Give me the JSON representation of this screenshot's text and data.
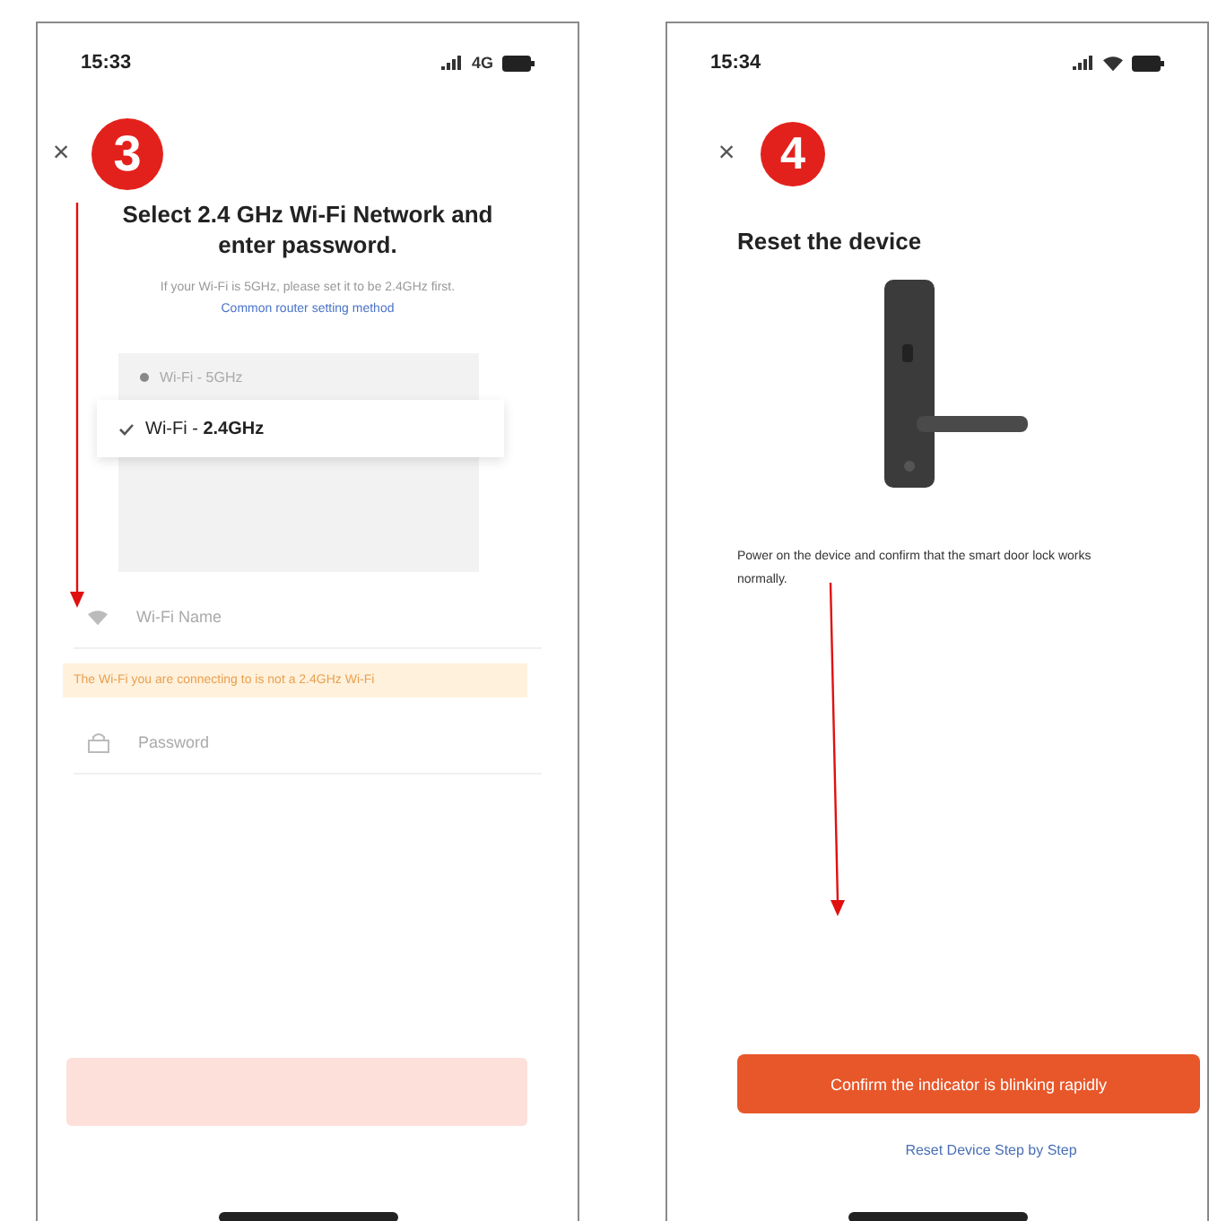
{
  "left_screen": {
    "status_time": "15:33",
    "network": "4G",
    "close": "×",
    "step": "3",
    "title": "Select 2.4 GHz Wi-Fi Network and enter password.",
    "subtitle": "If your Wi-Fi is 5GHz, please set it to be 2.4GHz first.",
    "subtitle_link": "Common router setting method",
    "networks": [
      {
        "label": "Wi-Fi - 5GHz",
        "selected": false
      },
      {
        "label": "Wi-Fi - **2.4GHz**",
        "selected": true
      }
    ],
    "wifi_name": {
      "placeholder": "Wi-Fi Name"
    },
    "warning": "The Wi-Fi you are connecting to is not a 2.4GHz Wi-Fi",
    "password": {
      "placeholder": "Password"
    },
    "next_button": {
      "disabled": true
    }
  },
  "right_screen": {
    "status_time": "15:34",
    "close": "×",
    "step": "4",
    "title": "Reset the device",
    "instruction": "Power on the device and confirm that the smart door lock works normally.",
    "confirm_button": "Confirm the indicator is blinking rapidly",
    "help_link": "Reset Device Step by Step"
  }
}
